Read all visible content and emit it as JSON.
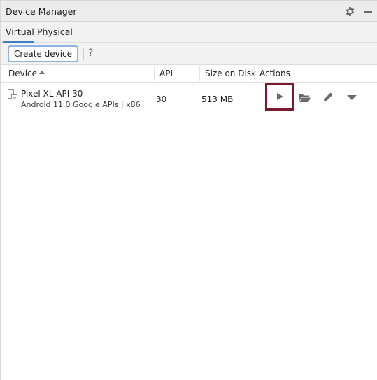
{
  "window": {
    "title": "Device Manager",
    "settings_icon": "gear-icon",
    "minimize_icon": "minimize-icon"
  },
  "tabs": [
    {
      "label": "Virtual",
      "active": true
    },
    {
      "label": "Physical",
      "active": false
    }
  ],
  "toolbar": {
    "create_device_label": "Create device",
    "help_label": "?"
  },
  "table": {
    "columns": [
      {
        "label": "Device",
        "sort": "ascending"
      },
      {
        "label": "API"
      },
      {
        "label": "Size on Disk"
      },
      {
        "label": "Actions"
      }
    ],
    "rows": [
      {
        "name": "Pixel XL API 30",
        "description": "Android 11.0 Google APIs | x86",
        "api": "30",
        "size": "513 MB",
        "actions": [
          "launch-icon",
          "folder-icon",
          "edit-icon",
          "more-menu-icon"
        ]
      }
    ]
  },
  "highlight": {
    "target": "launch-button",
    "color": "#7a1a2c"
  },
  "colors": {
    "accent": "#3d7fc1",
    "icon": "#6b6b6b"
  }
}
